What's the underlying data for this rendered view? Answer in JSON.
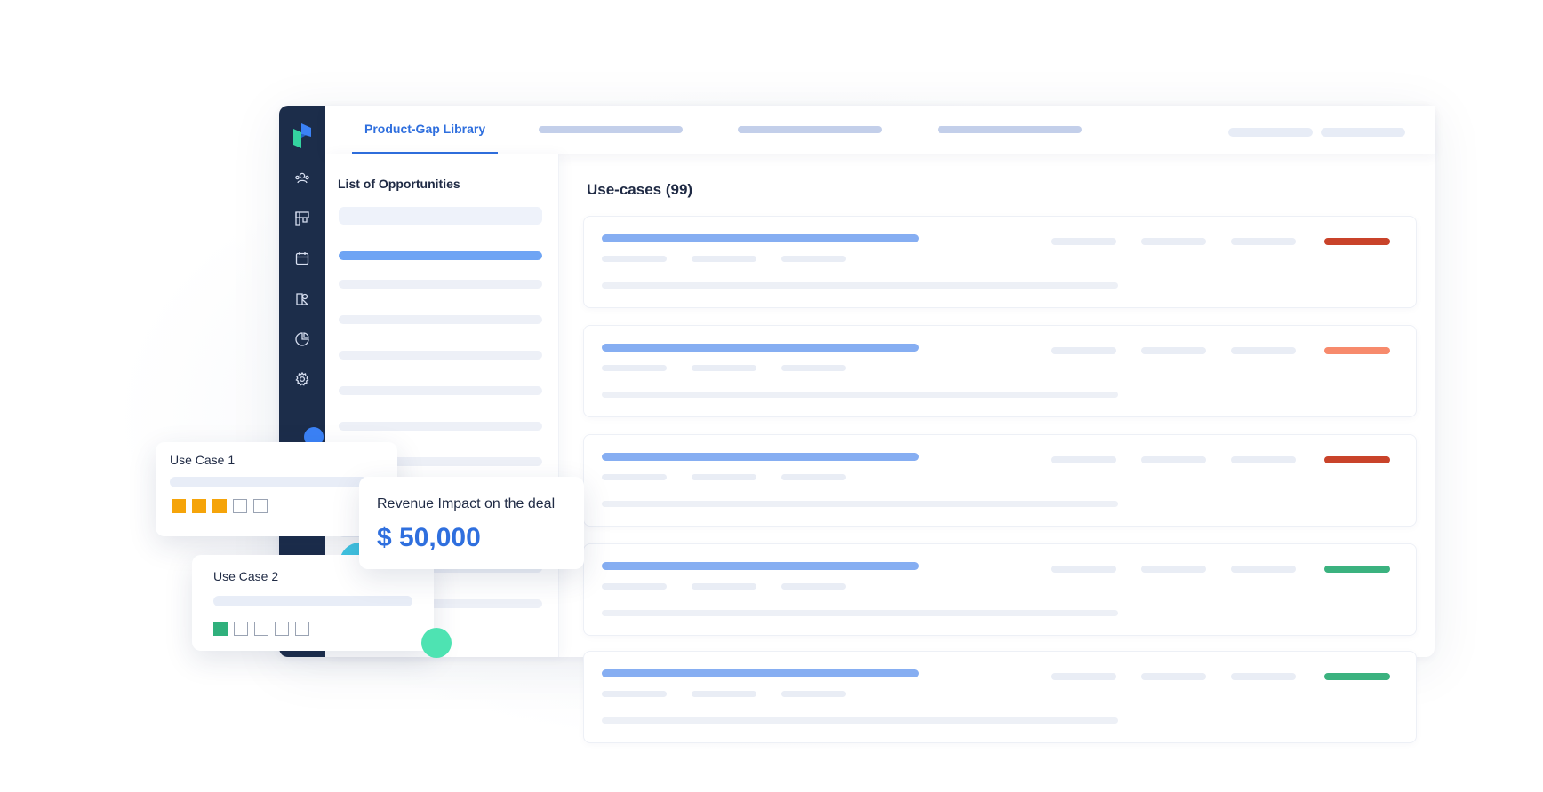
{
  "tabs": {
    "active_label": "Product-Gap Library"
  },
  "sidebar": {
    "icons": [
      "logo-icon",
      "people-icon",
      "board-icon",
      "calendar-icon",
      "reports-icon",
      "pie-chart-icon",
      "settings-icon"
    ]
  },
  "opportunities": {
    "title": "List of Opportunities"
  },
  "usecases": {
    "title": "Use-cases (99)",
    "status_colors": [
      "#c9432a",
      "#f78a6c",
      "#c9432a",
      "#3bb27f",
      "#3bb27f"
    ]
  },
  "float_cards": {
    "use_case_1": {
      "title": "Use Case 1",
      "rating": 3,
      "max": 5,
      "color": "#f5a40a"
    },
    "use_case_2": {
      "title": "Use Case 2",
      "rating": 1,
      "max": 5,
      "color": "#2fb07c"
    },
    "revenue": {
      "label": "Revenue Impact on the deal",
      "value": "$ 50,000"
    }
  },
  "colors": {
    "accent": "#2f6fde",
    "sidebar": "#1c2d4a"
  }
}
